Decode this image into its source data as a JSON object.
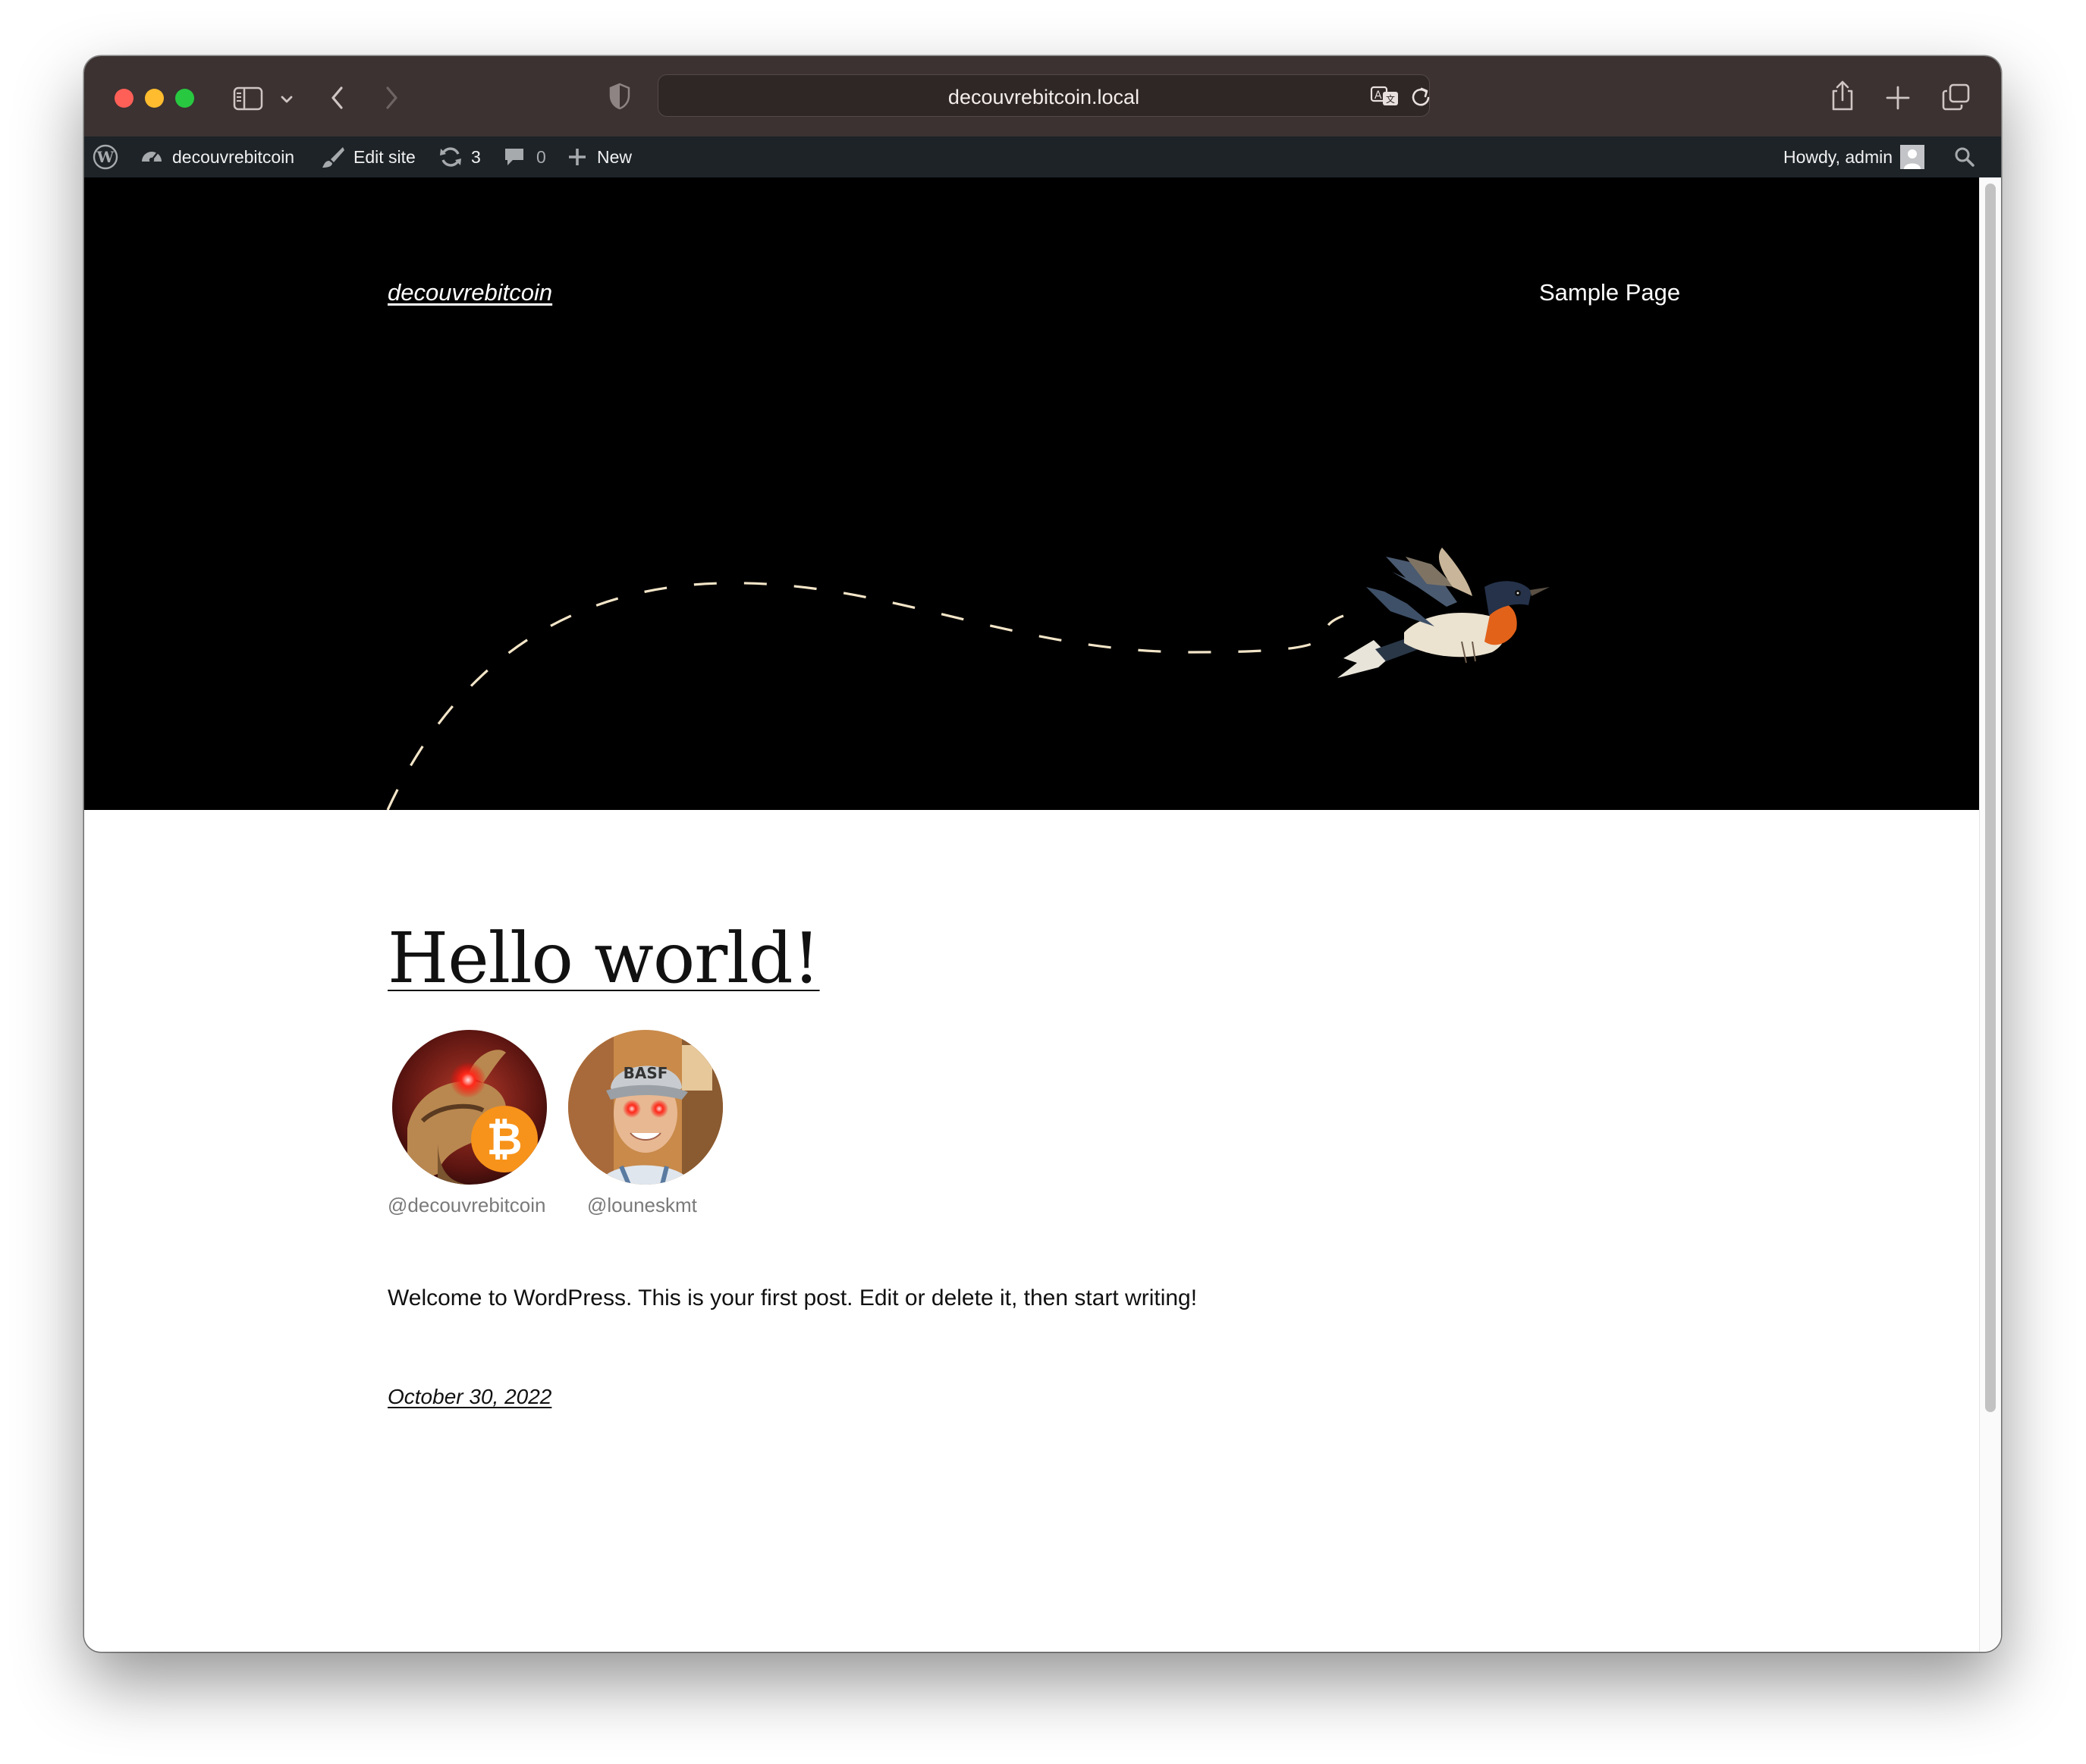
{
  "browser": {
    "url": "decouvrebitcoin.local"
  },
  "admin_bar": {
    "site_name": "decouvrebitcoin",
    "edit_site": "Edit site",
    "updates_count": "3",
    "comments_count": "0",
    "new_label": "New",
    "greeting": "Howdy, admin"
  },
  "site": {
    "title": "decouvrebitcoin",
    "nav": [
      "Sample Page"
    ]
  },
  "post": {
    "title": "Hello world!",
    "authors": [
      {
        "handle": "@decouvrebitcoin"
      },
      {
        "handle": "@louneskmt"
      }
    ],
    "body": "Welcome to WordPress. This is your first post. Edit or delete it, then start writing!",
    "date": "October 30, 2022"
  },
  "icons": {
    "toolbar": [
      "sidebar-icon",
      "chevron-down-icon",
      "back-icon",
      "forward-icon",
      "shield-icon",
      "translate-icon",
      "reload-icon",
      "share-icon",
      "new-tab-icon",
      "tabs-overview-icon"
    ],
    "admin_bar": [
      "wordpress-logo-icon",
      "dashboard-icon",
      "brush-icon",
      "updates-icon",
      "comment-icon",
      "plus-icon",
      "avatar-icon",
      "search-icon"
    ]
  },
  "colors": {
    "toolbar_bg": "#3b3231",
    "adminbar_bg": "#1d2327",
    "hero_bg": "#000000",
    "path_dash": "#f3e5c8",
    "bitcoin_orange": "#f7931a"
  }
}
